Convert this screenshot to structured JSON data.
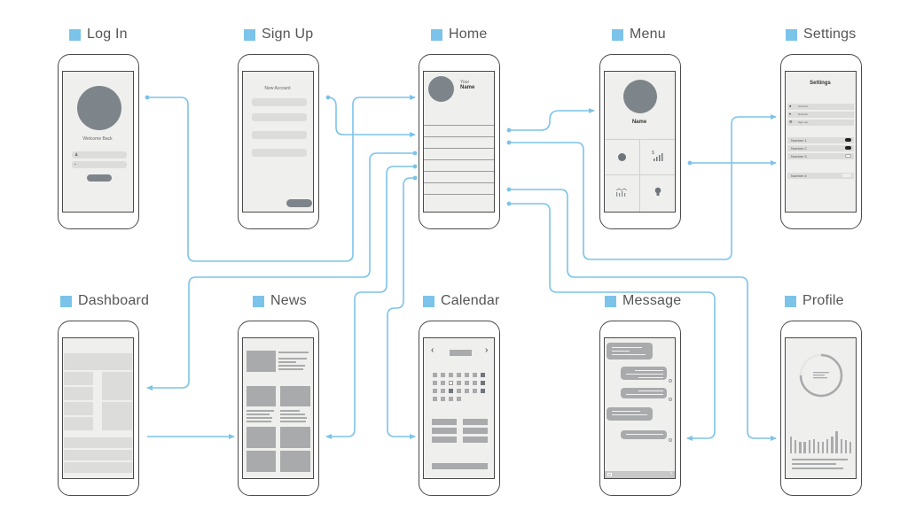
{
  "colors": {
    "accent": "#7cc3ea",
    "flow_line": "#7cc3ea",
    "outline": "#4a4a4a",
    "placeholder": "#7e858a",
    "screen_bg": "#efefed"
  },
  "screens": {
    "login": {
      "title": "Log In",
      "welcome": "Welcome Back",
      "username_icon": "user-icon",
      "password_icon": "lock-icon"
    },
    "signup": {
      "title": "Sign Up",
      "heading": "New Account"
    },
    "home": {
      "title": "Home",
      "your": "Your",
      "name": "Name"
    },
    "menu": {
      "title": "Menu",
      "name": "Name",
      "tiles": [
        "pie-chart-icon",
        "dollar-bar-chart-icon",
        "line-bar-chart-icon",
        "lightbulb-icon"
      ]
    },
    "settings": {
      "title": "Settings",
      "heading": "Settings",
      "account_rows": [
        {
          "icon": "search-icon",
          "label": "Account"
        },
        {
          "icon": "wifi-icon",
          "label": "Network"
        },
        {
          "icon": "gear-icon",
          "label": "Sign out"
        }
      ],
      "toggle_rows": [
        {
          "label": "Number 1",
          "state": "on"
        },
        {
          "label": "Number 2",
          "state": "on"
        },
        {
          "label": "Number 3",
          "state": "off"
        }
      ],
      "stepper_row": {
        "label": "Number 4"
      }
    },
    "dashboard": {
      "title": "Dashboard"
    },
    "news": {
      "title": "News"
    },
    "calendar": {
      "title": "Calendar",
      "prev": "‹",
      "next": "›"
    },
    "message": {
      "title": "Message",
      "send": "›"
    },
    "profile": {
      "title": "Profile",
      "progress": 0.75,
      "bars": [
        0.62,
        0.5,
        0.45,
        0.45,
        0.5,
        0.55,
        0.45,
        0.45,
        0.55,
        0.65,
        0.85,
        0.55,
        0.5,
        0.45
      ]
    }
  },
  "flows": [
    {
      "from": "login",
      "to": "home"
    },
    {
      "from": "signup",
      "to": "home"
    },
    {
      "from": "home",
      "to": "dashboard"
    },
    {
      "from": "home",
      "to": "news"
    },
    {
      "from": "home",
      "to": "calendar"
    },
    {
      "from": "dashboard",
      "to": "news"
    },
    {
      "from": "home",
      "to": "menu"
    },
    {
      "from": "home",
      "to": "settings"
    },
    {
      "from": "menu",
      "to": "settings"
    },
    {
      "from": "home",
      "to": "profile"
    },
    {
      "from": "home",
      "to": "message"
    }
  ]
}
